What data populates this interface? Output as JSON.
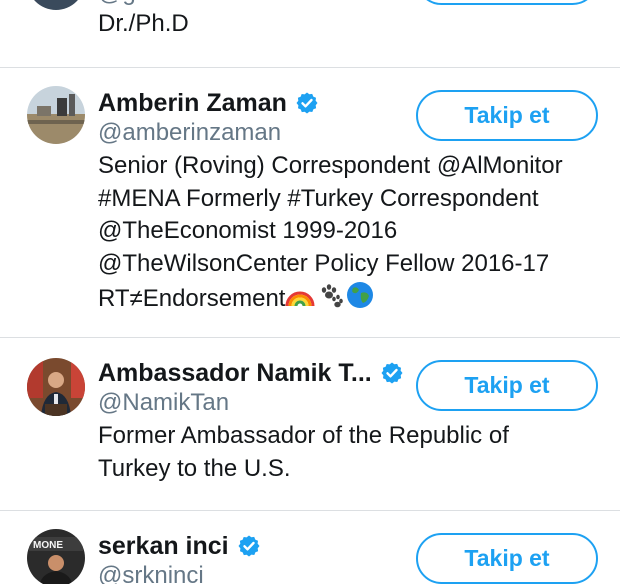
{
  "colors": {
    "accent": "#1da1f2",
    "text": "#14171a",
    "secondary": "#657786",
    "divider": "#dcdfe2"
  },
  "top_partial": {
    "handle_fragment": "@g",
    "bio": "Dr./Ph.D"
  },
  "users": [
    {
      "name": "Amberin Zaman",
      "verified": true,
      "handle": "@amberinzaman",
      "follow_label": "Takip et",
      "bio_lines": [
        "Senior (Roving) Correspondent @AlMonitor",
        "#MENA Formerly #Turkey Correspondent",
        "@TheEconomist 1999-2016",
        "@TheWilsonCenter Policy Fellow 2016-17",
        "RT≠Endorsement"
      ],
      "bio_emojis": [
        "rainbow-icon",
        "paw-prints-icon",
        "globe-icon"
      ]
    },
    {
      "name": "Ambassador Namik T...",
      "verified": true,
      "handle": "@NamikTan",
      "follow_label": "Takip et",
      "bio_lines": [
        "Former Ambassador of the Republic of",
        "Turkey to the U.S."
      ]
    },
    {
      "name": "serkan inci",
      "verified": true,
      "handle": "@srkninci",
      "follow_label": "Takip et",
      "avatar_text": "MONE"
    }
  ]
}
